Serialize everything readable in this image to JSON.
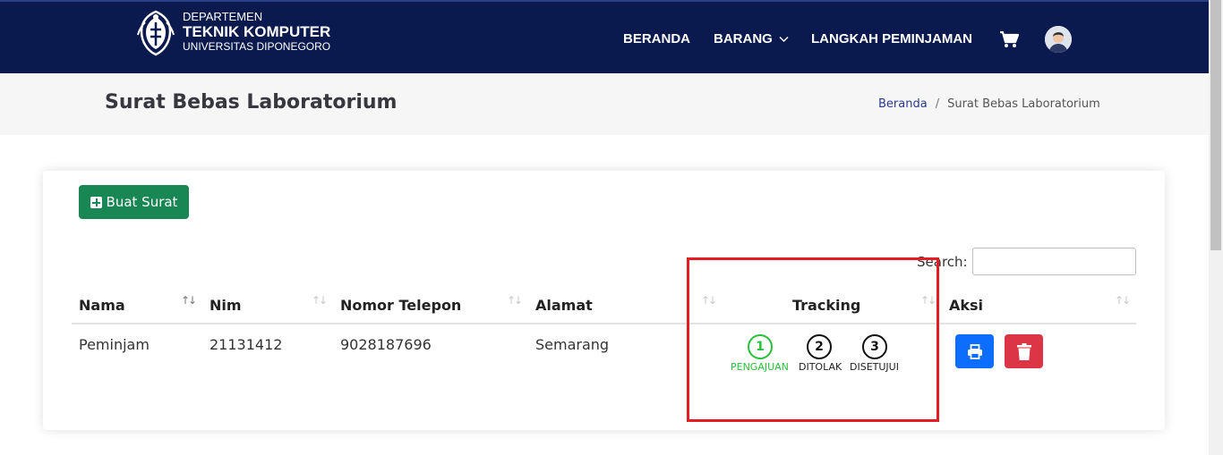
{
  "brand": {
    "line1": "DEPARTEMEN",
    "line2": "TEKNIK KOMPUTER",
    "line3": "UNIVERSITAS DIPONEGORO"
  },
  "nav": {
    "home": "BERANDA",
    "items": "BARANG",
    "steps": "LANGKAH PEMINJAMAN"
  },
  "page": {
    "title": "Surat Bebas Laboratorium"
  },
  "breadcrumb": {
    "home": "Beranda",
    "sep": "/",
    "current": "Surat Bebas Laboratorium"
  },
  "toolbar": {
    "create_label": "Buat Surat"
  },
  "search": {
    "label": "Search:",
    "value": ""
  },
  "table": {
    "columns": [
      "Nama",
      "Nim",
      "Nomor Telepon",
      "Alamat",
      "Tracking",
      "Aksi"
    ],
    "rows": [
      {
        "nama": "Peminjam",
        "nim": "21131412",
        "telepon": "9028187696",
        "alamat": "Semarang"
      }
    ]
  },
  "tracking": {
    "steps": [
      {
        "num": "1",
        "label": "PENGAJUAN"
      },
      {
        "num": "2",
        "label": "DITOLAK"
      },
      {
        "num": "3",
        "label": "DISETUJUI"
      }
    ],
    "active_step": 1
  },
  "colors": {
    "navbar": "#0b1a4e",
    "create_button": "#198754",
    "print_button": "#0d6efd",
    "delete_button": "#dc3545",
    "step_active": "#28c13a",
    "highlight_box": "#e31c25"
  },
  "icons": {
    "create": "plus-square-icon",
    "print": "printer-icon",
    "delete": "trash-icon",
    "cart": "cart-icon",
    "sort": "sort-arrows-icon"
  }
}
